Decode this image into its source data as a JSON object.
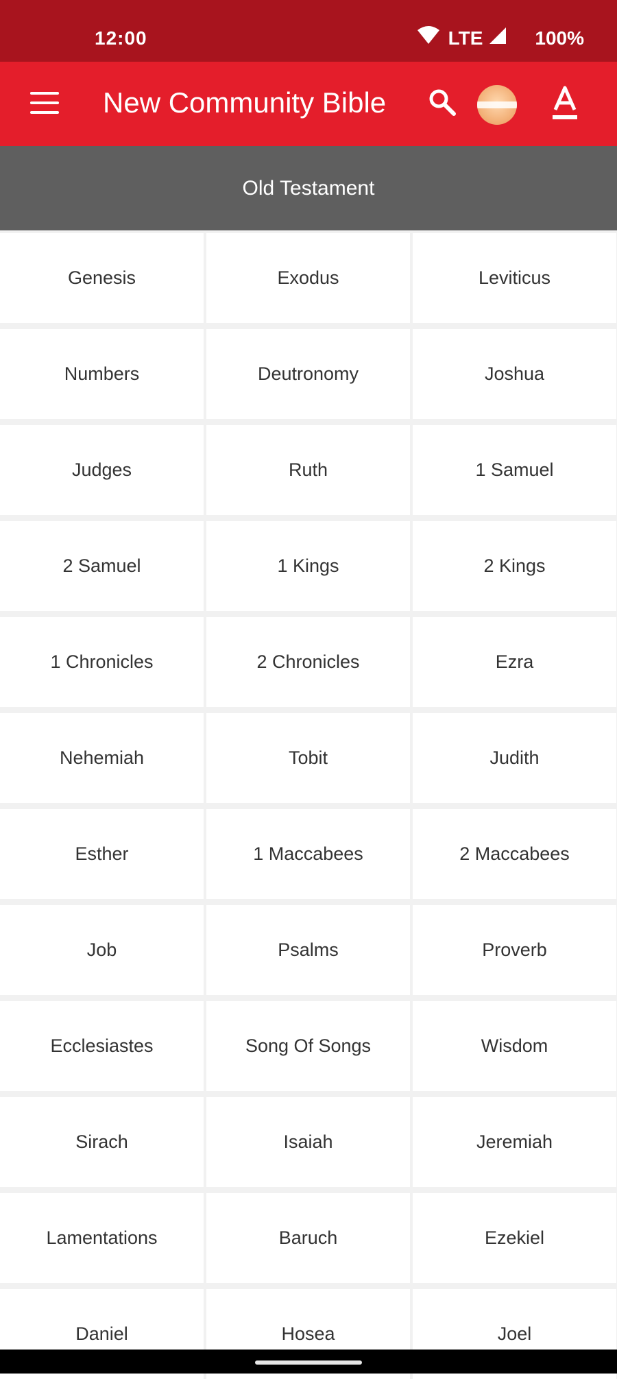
{
  "status": {
    "time": "12:00",
    "network": "LTE",
    "battery": "100%"
  },
  "app_bar": {
    "title": "New Community Bible",
    "icons": [
      "menu-icon",
      "search-icon",
      "avatar",
      "font-size-icon"
    ]
  },
  "section": {
    "title": "Old Testament"
  },
  "colors": {
    "status_bar": "#a8141e",
    "app_bar": "#e41e2b",
    "section_header": "#5f5f5f",
    "cell_bg": "#ffffff",
    "text": "#333333"
  },
  "books": [
    "Genesis",
    "Exodus",
    "Leviticus",
    "Numbers",
    "Deutronomy",
    "Joshua",
    "Judges",
    "Ruth",
    "1 Samuel",
    "2 Samuel",
    "1 Kings",
    "2 Kings",
    "1 Chronicles",
    "2 Chronicles",
    "Ezra",
    "Nehemiah",
    "Tobit",
    "Judith",
    "Esther",
    "1 Maccabees",
    "2 Maccabees",
    "Job",
    "Psalms",
    "Proverb",
    "Ecclesiastes",
    "Song Of Songs",
    "Wisdom",
    "Sirach",
    "Isaiah",
    "Jeremiah",
    "Lamentations",
    "Baruch",
    "Ezekiel",
    "Daniel",
    "Hosea",
    "Joel"
  ]
}
